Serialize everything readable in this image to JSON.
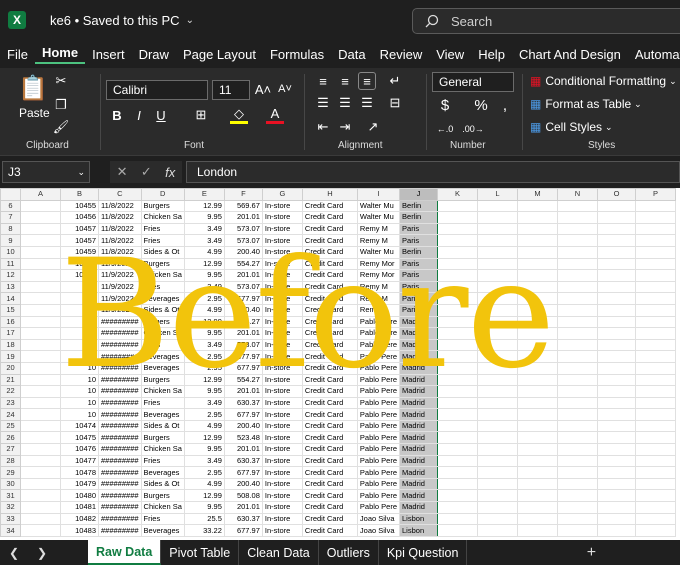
{
  "window": {
    "title": "ke6 • Saved to this PC",
    "search_placeholder": "Search",
    "logo": "X"
  },
  "menu": [
    "File",
    "Home",
    "Insert",
    "Draw",
    "Page Layout",
    "Formulas",
    "Data",
    "Review",
    "View",
    "Help",
    "Chart And Design",
    "Automate"
  ],
  "ribbon": {
    "clipboard": {
      "label": "Clipboard",
      "paste": "Paste"
    },
    "font": {
      "label": "Font",
      "name": "Calibri",
      "size": "11"
    },
    "alignment": {
      "label": "Alignment"
    },
    "number": {
      "label": "Number",
      "format": "General"
    },
    "styles": {
      "label": "Styles",
      "conditional": "Conditional Formatting",
      "format_table": "Format as Table",
      "cell_styles": "Cell Styles"
    }
  },
  "formula": {
    "name_box": "J3",
    "value": "London"
  },
  "columns": [
    "A",
    "B",
    "C",
    "D",
    "E",
    "F",
    "G",
    "H",
    "I",
    "J",
    "K",
    "L",
    "M",
    "N",
    "O",
    "P"
  ],
  "rows": [
    {
      "r": "6",
      "c": [
        "",
        "10455",
        "11/8/2022",
        "Burgers",
        "12.99",
        "569.67",
        "In-store",
        "Credit Card",
        "Walter Mu",
        "Berlin"
      ]
    },
    {
      "r": "7",
      "c": [
        "",
        "10456",
        "11/8/2022",
        "Chicken Sa",
        "9.95",
        "201.01",
        "In-store",
        "Credit Card",
        "Walter Mu",
        "Berlin"
      ]
    },
    {
      "r": "8",
      "c": [
        "",
        "10457",
        "11/8/2022",
        "Fries",
        "3.49",
        "573.07",
        "In-store",
        "Credit Card",
        "Remy   M",
        "Paris"
      ]
    },
    {
      "r": "9",
      "c": [
        "",
        "10457",
        "11/8/2022",
        "Fries",
        "3.49",
        "573.07",
        "In-store",
        "Credit Card",
        "Remy   M",
        "Paris"
      ]
    },
    {
      "r": "10",
      "c": [
        "",
        "10459",
        "11/8/2022",
        "Sides & Ot",
        "4.99",
        "200.40",
        "In-store",
        "Credit Card",
        "Walter Mu",
        "Berlin"
      ]
    },
    {
      "r": "11",
      "c": [
        "",
        "10460",
        "11/9/2022",
        "Burgers",
        "12.99",
        "554.27",
        "In-store",
        "Credit Card",
        "Remy Mor",
        "Paris"
      ]
    },
    {
      "r": "12",
      "c": [
        "",
        "10461",
        "11/9/2022",
        "Chicken Sa",
        "9.95",
        "201.01",
        "In-store",
        "Credit Card",
        "Remy Mor",
        "Paris"
      ]
    },
    {
      "r": "13",
      "c": [
        "",
        "10",
        "11/9/2022",
        "Fries",
        "3.49",
        "573.07",
        "In-store",
        "Credit Card",
        "Remy   M",
        "Paris"
      ]
    },
    {
      "r": "14",
      "c": [
        "",
        "10",
        "11/9/2022",
        "Beverages",
        "2.95",
        "677.97",
        "In-store",
        "Credit Card",
        "Remy   M",
        "Paris"
      ]
    },
    {
      "r": "15",
      "c": [
        "",
        "10",
        "11/9/2022",
        "Sides & Ot",
        "4.99",
        "200.40",
        "In-store",
        "Credit Card",
        "Remy   M",
        "Paris"
      ]
    },
    {
      "r": "16",
      "c": [
        "",
        "10",
        "#########",
        "Burgers",
        "12.99",
        "554.27",
        "In-store",
        "Credit Card",
        "Pablo Pere",
        "Madrid"
      ]
    },
    {
      "r": "17",
      "c": [
        "",
        "10",
        "#########",
        "Chicken Sa",
        "9.95",
        "201.01",
        "In-store",
        "Credit Card",
        "Pablo Pere",
        "Madrid"
      ]
    },
    {
      "r": "18",
      "c": [
        "",
        "10",
        "#########",
        "Fries",
        "3.49",
        "573.07",
        "In-store",
        "Credit Card",
        "Pablo Pere",
        "Madrid"
      ]
    },
    {
      "r": "19",
      "c": [
        "",
        "10",
        "#########",
        "Beverages",
        "2.95",
        "677.97",
        "In-store",
        "Credit Card",
        "Pablo Pere",
        "Madrid"
      ]
    },
    {
      "r": "20",
      "c": [
        "",
        "10",
        "#########",
        "Beverages",
        "2.95",
        "677.97",
        "In-store",
        "Credit Card",
        "Pablo Pere",
        "Madrid"
      ]
    },
    {
      "r": "21",
      "c": [
        "",
        "10",
        "#########",
        "Burgers",
        "12.99",
        "554.27",
        "In-store",
        "Credit Card",
        "Pablo Pere",
        "Madrid"
      ]
    },
    {
      "r": "22",
      "c": [
        "",
        "10",
        "#########",
        "Chicken Sa",
        "9.95",
        "201.01",
        "In-store",
        "Credit Card",
        "Pablo Pere",
        "Madrid"
      ]
    },
    {
      "r": "23",
      "c": [
        "",
        "10",
        "#########",
        "Fries",
        "3.49",
        "630.37",
        "In-store",
        "Credit Card",
        "Pablo Pere",
        "Madrid"
      ]
    },
    {
      "r": "24",
      "c": [
        "",
        "10",
        "#########",
        "Beverages",
        "2.95",
        "677.97",
        "In-store",
        "Credit Card",
        "Pablo Pere",
        "Madrid"
      ]
    },
    {
      "r": "25",
      "c": [
        "",
        "10474",
        "#########",
        "Sides & Ot",
        "4.99",
        "200.40",
        "In-store",
        "Credit Card",
        "Pablo Pere",
        "Madrid"
      ]
    },
    {
      "r": "26",
      "c": [
        "",
        "10475",
        "#########",
        "Burgers",
        "12.99",
        "523.48",
        "In-store",
        "Credit Card",
        "Pablo Pere",
        "Madrid"
      ]
    },
    {
      "r": "27",
      "c": [
        "",
        "10476",
        "#########",
        "Chicken Sa",
        "9.95",
        "201.01",
        "In-store",
        "Credit Card",
        "Pablo Pere",
        "Madrid"
      ]
    },
    {
      "r": "28",
      "c": [
        "",
        "10477",
        "#########",
        "Fries",
        "3.49",
        "630.37",
        "In-store",
        "Credit Card",
        "Pablo Pere",
        "Madrid"
      ]
    },
    {
      "r": "29",
      "c": [
        "",
        "10478",
        "#########",
        "Beverages",
        "2.95",
        "677.97",
        "In-store",
        "Credit Card",
        "Pablo Pere",
        "Madrid"
      ]
    },
    {
      "r": "30",
      "c": [
        "",
        "10479",
        "#########",
        "Sides & Ot",
        "4.99",
        "200.40",
        "In-store",
        "Credit Card",
        "Pablo Pere",
        "Madrid"
      ]
    },
    {
      "r": "31",
      "c": [
        "",
        "10480",
        "#########",
        "Burgers",
        "12.99",
        "508.08",
        "In-store",
        "Credit Card",
        "Pablo Pere",
        "Madrid"
      ]
    },
    {
      "r": "32",
      "c": [
        "",
        "10481",
        "#########",
        "Chicken Sa",
        "9.95",
        "201.01",
        "In-store",
        "Credit Card",
        "Pablo Pere",
        "Madrid"
      ]
    },
    {
      "r": "33",
      "c": [
        "",
        "10482",
        "#########",
        "Fries",
        "25.5",
        "630.37",
        "In-store",
        "Credit Card",
        "Joao Silva",
        "Lisbon"
      ]
    },
    {
      "r": "34",
      "c": [
        "",
        "10483",
        "#########",
        "Beverages",
        "33.22",
        "677.97",
        "In-store",
        "Credit Card",
        "Joao Silva",
        "Lisbon"
      ]
    }
  ],
  "watermark": "Before",
  "tabs": [
    "Raw Data",
    "Pivot Table",
    "Clean Data",
    "Outliers",
    "Kpi Question"
  ],
  "active_tab": "Raw Data",
  "colors": {
    "accent": "#107c41",
    "watermark": "#f2c40c"
  }
}
